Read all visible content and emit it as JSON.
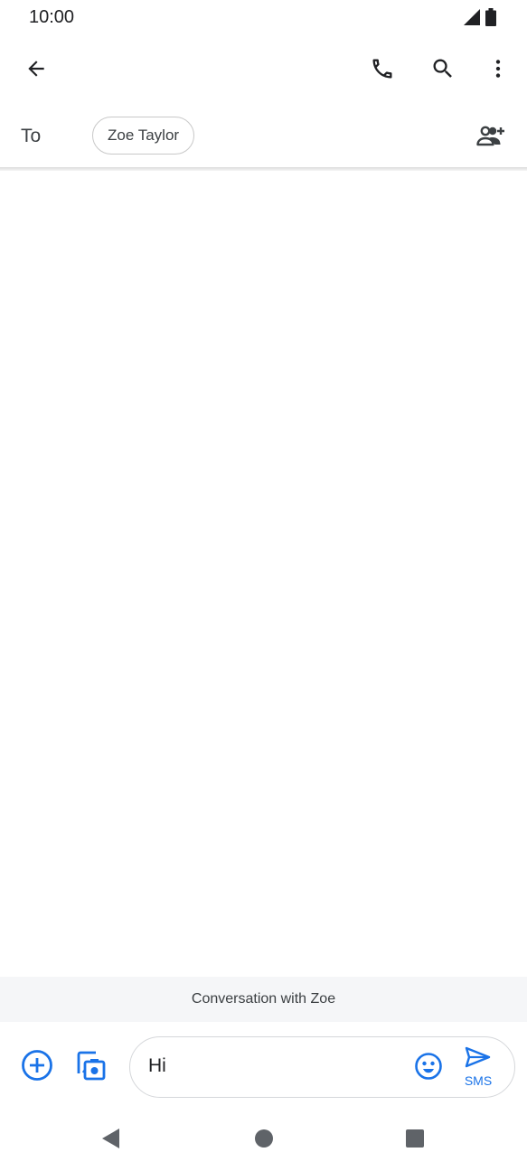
{
  "status_bar": {
    "time": "10:00",
    "icons": [
      "signal-icon",
      "battery-icon"
    ]
  },
  "app_bar": {
    "icons": [
      "back-arrow-icon",
      "phone-icon",
      "search-icon",
      "more-vert-icon"
    ]
  },
  "recipients": {
    "to_label": "To",
    "chips": [
      "Zoe Taylor"
    ],
    "add_icon": "add-people-icon"
  },
  "conversation": {
    "banner_text": "Conversation with Zoe"
  },
  "compose": {
    "attach_icon": "add-circle-icon",
    "gallery_icon": "gallery-camera-icon",
    "message_value": "Hi",
    "emoji_icon": "emoji-icon",
    "send_label": "SMS",
    "accent_color": "#1a73e8"
  },
  "nav_bar": {
    "icons": [
      "back-triangle-icon",
      "home-circle-icon",
      "recents-square-icon"
    ]
  }
}
